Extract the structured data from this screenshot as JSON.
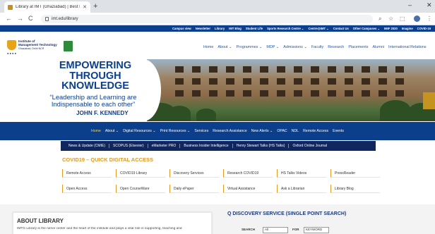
{
  "browser": {
    "tab_title": "Library at IMT (Ghaziabad) | Best I",
    "url": "imt.edu/library",
    "new_tab": "+",
    "win_min": "–",
    "win_close": "✕",
    "back": "←",
    "forward": "→",
    "reload": "C"
  },
  "utility_links": [
    "Campus view",
    "Newsletter",
    "Library",
    "IMT Blog",
    "Student Life",
    "Sports Research Centre ⌄",
    "Centre@IMT ⌄",
    "Contact Us",
    "Other Campuses ⌄",
    "IMIF 2020",
    "Imagine",
    "COVID-19"
  ],
  "logo": {
    "line1": "Institute of",
    "line2": "Management Technology",
    "line3": "Ghaziabad, Delhi NCR",
    "dots": "● ● ● ●"
  },
  "main_nav": [
    "Home",
    "About ⌄",
    "Programmes ⌄",
    "MDP ⌄",
    "Admissions ⌄",
    "Faculty",
    "Research",
    "Placements",
    "Alumni",
    "International Relations"
  ],
  "banner": {
    "heading_1": "EMPOWERING",
    "heading_2": "THROUGH",
    "heading_3": "KNOWLEDGE",
    "quote_1": "“Leadership and Learning are",
    "quote_2": "Indispensable to each other”",
    "author": "JOHN F. KENNEDY"
  },
  "library_nav": [
    {
      "label": "Home",
      "active": true
    },
    {
      "label": "About ⌄"
    },
    {
      "label": "Digital Resources ⌄"
    },
    {
      "label": "Print Resources ⌄"
    },
    {
      "label": "Services"
    },
    {
      "label": "Research Assistance"
    },
    {
      "label": "New Alerts ⌄"
    },
    {
      "label": "OPAC"
    },
    {
      "label": "NDL"
    },
    {
      "label": "Remote Access"
    },
    {
      "label": "Events"
    }
  ],
  "news_strip": [
    "News & Update (CMIE)",
    "SCOPUS (Elsevier)",
    "eMarketer PRO",
    "Business Insider Intelligence",
    "Henry Stewart Talks (HS Talks)",
    "Oxford Online Journal"
  ],
  "quick_access": {
    "title": "COVID19 – QUICK DIGITAL ACCESS",
    "row1": [
      "Remote Access",
      "COVID19 Library",
      "Discovery Services",
      "Research COVID19",
      "HS Talks Videos",
      "PressReader"
    ],
    "row2": [
      "Open Access",
      "Open CourseWare",
      "Daily ePaper",
      "Virtual Assistance",
      "Ask a Librarian",
      "Library Blog"
    ]
  },
  "about": {
    "title": "ABOUT LIBRARY",
    "text": "IMTG Library is the nerve center and the heart of the institute and plays a vital role in supporting, teaching and"
  },
  "discovery": {
    "title": "Q DISCOVERY SERVICE (SINGLE POINT SEARCH)",
    "search_label": "SEARCH",
    "select_1": "All",
    "for_label": "FOR",
    "select_2": "KEYWORD"
  },
  "colors": {
    "brand_blue": "#0b3f8c",
    "accent_gold": "#dd9a25",
    "news_navy": "#10265e"
  }
}
